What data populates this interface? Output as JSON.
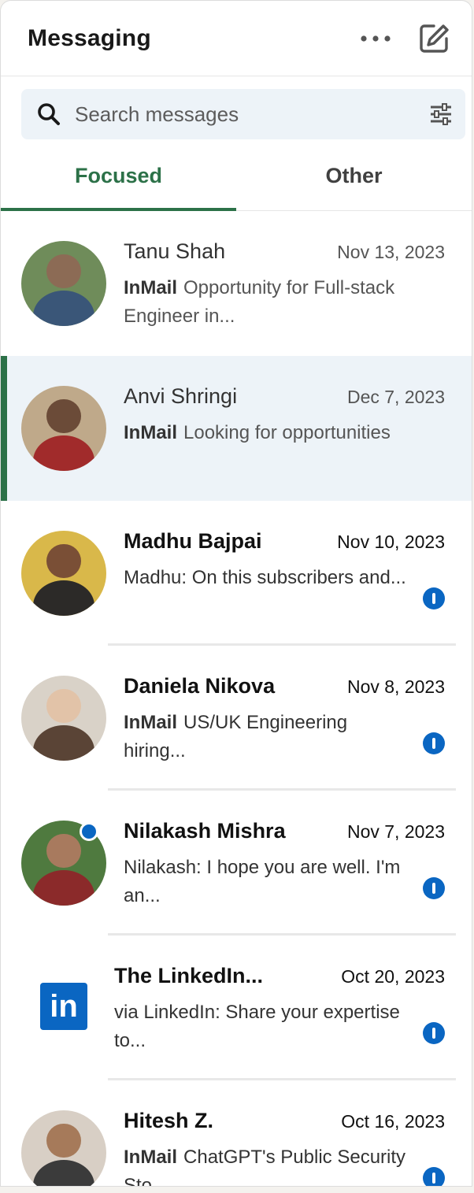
{
  "header": {
    "title": "Messaging"
  },
  "search": {
    "placeholder": "Search messages"
  },
  "tabs": [
    {
      "label": "Focused",
      "active": true
    },
    {
      "label": "Other",
      "active": false
    }
  ],
  "conversations": [
    {
      "name": "Tanu Shah",
      "date": "Nov 13, 2023",
      "preview_label": "InMail",
      "preview_text": "Opportunity for Full-stack Engineer in...",
      "unread": false,
      "selected": false,
      "avatar_colors": {
        "bg": "#6f8c5a",
        "face": "#8c6b55",
        "body": "#3a5678"
      }
    },
    {
      "name": "Anvi Shringi",
      "date": "Dec 7, 2023",
      "preview_label": "InMail",
      "preview_text": "Looking for opportunities",
      "unread": false,
      "selected": true,
      "avatar_colors": {
        "bg": "#bfa98a",
        "face": "#6b4b38",
        "body": "#a12b2b"
      }
    },
    {
      "name": "Madhu Bajpai",
      "date": "Nov 10, 2023",
      "preview_label": "",
      "preview_text": "Madhu: On this subscribers and...",
      "unread": true,
      "selected": false,
      "avatar_colors": {
        "bg": "#d9b84a",
        "face": "#7a4f36",
        "body": "#2c2a28"
      }
    },
    {
      "name": "Daniela Nikova",
      "date": "Nov 8, 2023",
      "preview_label": "InMail",
      "preview_text": "US/UK Engineering hiring...",
      "unread": true,
      "selected": false,
      "avatar_colors": {
        "bg": "#d9d2c8",
        "face": "#e2c3a8",
        "body": "#5a4436"
      }
    },
    {
      "name": "Nilakash Mishra",
      "date": "Nov 7, 2023",
      "preview_label": "",
      "preview_text": "Nilakash: I hope you are well. I'm an...",
      "unread": true,
      "selected": false,
      "online": true,
      "avatar_colors": {
        "bg": "#4f7a3f",
        "face": "#a87a5e",
        "body": "#8b2a2a"
      }
    },
    {
      "name": "The LinkedIn...",
      "date": "Oct 20, 2023",
      "preview_label": "",
      "preview_text": "via LinkedIn: Share your expertise to...",
      "unread": true,
      "selected": false,
      "is_logo": true,
      "logo_text": "in"
    },
    {
      "name": "Hitesh Z.",
      "date": "Oct 16, 2023",
      "preview_label": "InMail",
      "preview_text": "ChatGPT's Public Security Sto...",
      "unread": true,
      "selected": false,
      "avatar_colors": {
        "bg": "#d8cfc5",
        "face": "#a67a5a",
        "body": "#3b3b3b"
      }
    }
  ],
  "colors": {
    "accent": "#2c7148",
    "brand": "#0a66c2",
    "selected_bg": "#edf3f8"
  }
}
